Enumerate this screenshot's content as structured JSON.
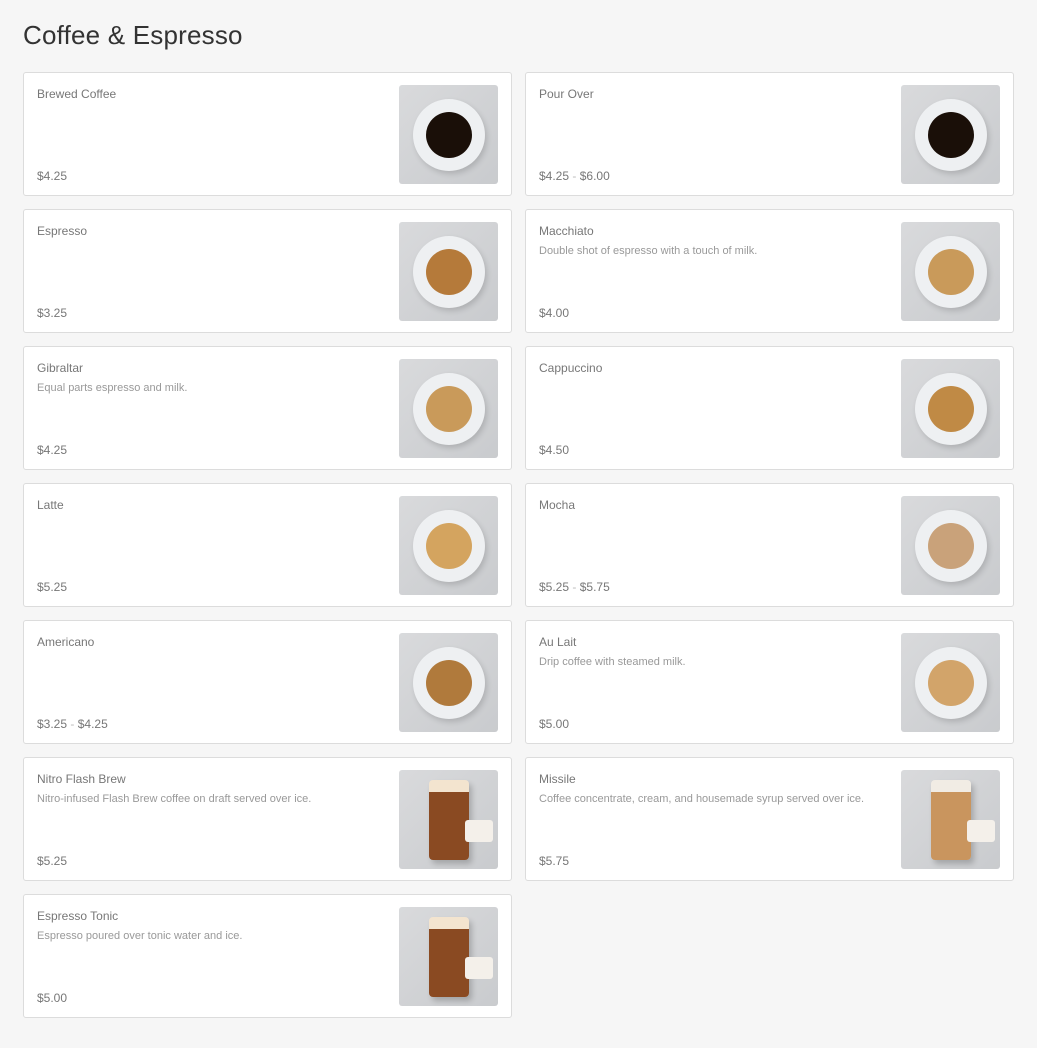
{
  "title": "Coffee & Espresso",
  "price_separator": "-",
  "items": [
    {
      "name": "Brewed Coffee",
      "description": "",
      "prices": [
        "$4.25"
      ],
      "image": "black-coffee-mug",
      "liquid": "#1a0f08"
    },
    {
      "name": "Pour Over",
      "description": "",
      "prices": [
        "$4.25",
        "$6.00"
      ],
      "image": "pour-over-carafe",
      "liquid": "#1a0f08"
    },
    {
      "name": "Espresso",
      "description": "",
      "prices": [
        "$3.25"
      ],
      "image": "espresso-cup",
      "liquid": "#b57a3a"
    },
    {
      "name": "Macchiato",
      "description": "Double shot of espresso with a touch of milk.",
      "prices": [
        "$4.00"
      ],
      "image": "macchiato-latte-art",
      "liquid": "#c99a5a"
    },
    {
      "name": "Gibraltar",
      "description": "Equal parts espresso and milk.",
      "prices": [
        "$4.25"
      ],
      "image": "gibraltar-glass",
      "liquid": "#c99a5a"
    },
    {
      "name": "Cappuccino",
      "description": "",
      "prices": [
        "$4.50"
      ],
      "image": "cappuccino-latte-art",
      "liquid": "#c08a45"
    },
    {
      "name": "Latte",
      "description": "",
      "prices": [
        "$5.25"
      ],
      "image": "latte-art",
      "liquid": "#d4a45f"
    },
    {
      "name": "Mocha",
      "description": "",
      "prices": [
        "$5.25",
        "$5.75"
      ],
      "image": "mocha-latte-art",
      "liquid": "#c9a27a"
    },
    {
      "name": "Americano",
      "description": "",
      "prices": [
        "$3.25",
        "$4.25"
      ],
      "image": "americano-cup",
      "liquid": "#b07a3c"
    },
    {
      "name": "Au Lait",
      "description": "Drip coffee with steamed milk.",
      "prices": [
        "$5.00"
      ],
      "image": "au-lait-latte-art",
      "liquid": "#d2a46a"
    },
    {
      "name": "Nitro Flash Brew",
      "description": "Nitro-infused Flash Brew coffee on draft served over ice.",
      "prices": [
        "$5.25"
      ],
      "image": "nitro-glass",
      "liquid": "dark"
    },
    {
      "name": "Missile",
      "description": "Coffee concentrate, cream, and housemade syrup served over ice.",
      "prices": [
        "$5.75"
      ],
      "image": "missile-glass",
      "liquid": "light"
    },
    {
      "name": "Espresso Tonic",
      "description": "Espresso poured over tonic water and ice.",
      "prices": [
        "$5.00"
      ],
      "image": "espresso-tonic-glass",
      "liquid": "dark"
    }
  ]
}
